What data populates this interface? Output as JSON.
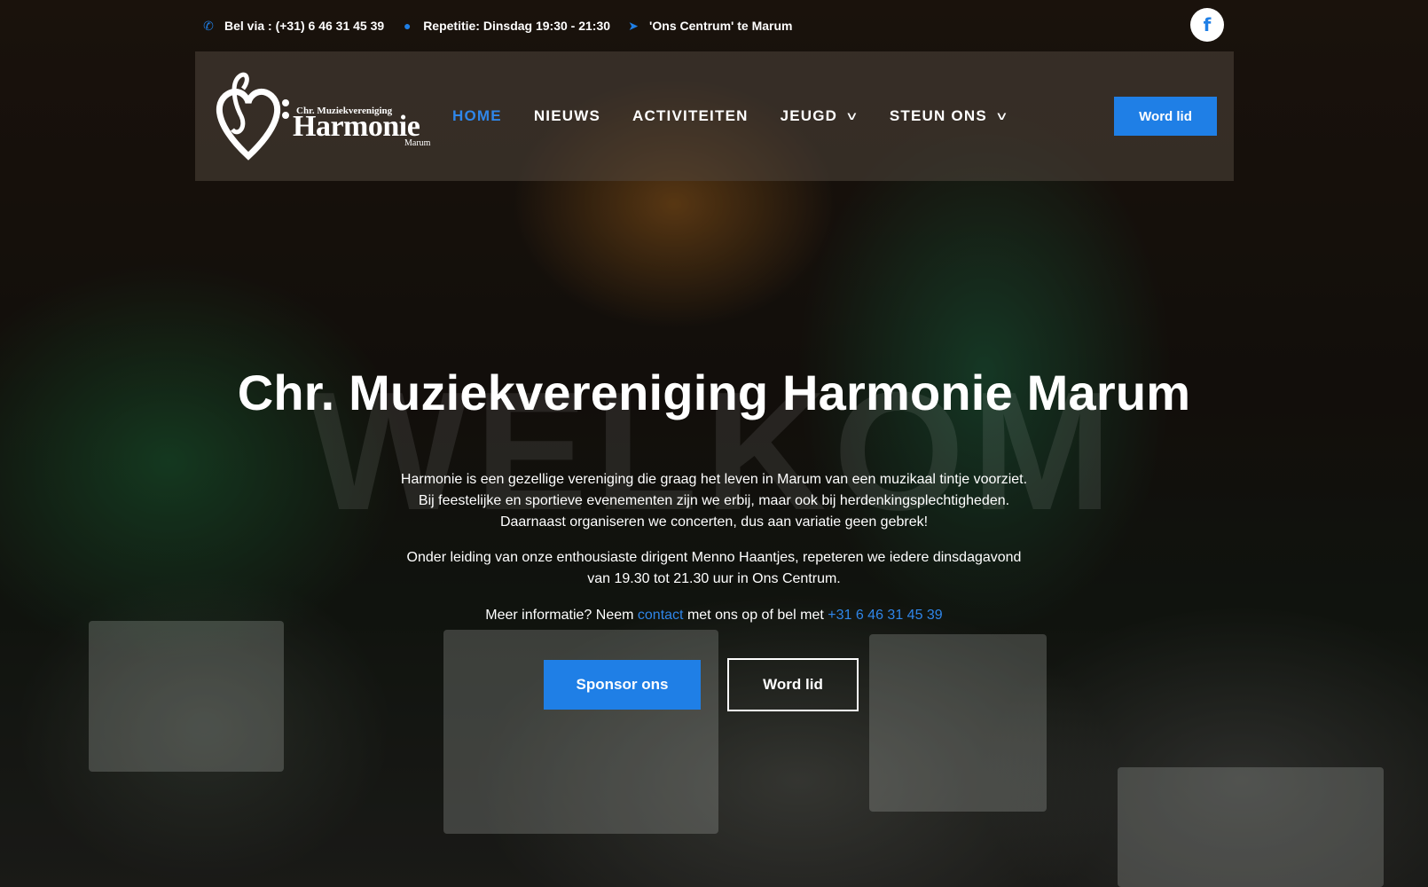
{
  "topbar": {
    "phone": "Bel via : (+31) 6 46 31 45 39",
    "rehearsal": "Repetitie: Dinsdag 19:30 - 21:30",
    "location": "'Ons Centrum' te Marum",
    "facebook_icon": "f"
  },
  "logo": {
    "small": "Chr. Muziekvereniging",
    "big": "Harmonie",
    "tiny": "Marum"
  },
  "nav": {
    "items": [
      {
        "label": "HOME"
      },
      {
        "label": "NIEUWS"
      },
      {
        "label": "ACTIVITEITEN"
      },
      {
        "label": "JEUGD"
      },
      {
        "label": "STEUN ONS"
      }
    ],
    "cta": "Word lid"
  },
  "hero": {
    "watermark": "WELKOM",
    "title": "Chr. Muziekvereniging Harmonie Marum",
    "paragraph1_line1": "Harmonie is een gezellige vereniging die graag het leven in Marum van een muzikaal tintje voorziet.",
    "paragraph1_line2": "Bij feestelijke en sportieve evenementen zijn we erbij, maar ook bij herdenkingsplechtigheden.",
    "paragraph1_line3": "Daarnaast organiseren we concerten, dus aan variatie geen gebrek!",
    "paragraph2_line1": "Onder leiding van onze enthousiaste dirigent Menno Haantjes, repeteren we iedere dinsdagavond",
    "paragraph2_line2": "van 19.30 tot 21.30 uur in Ons Centrum.",
    "paragraph3_pre": "Meer informatie? Neem ",
    "paragraph3_link": "contact",
    "paragraph3_mid": " met ons op of bel met ",
    "paragraph3_phone": "+31 6 46 31 45 39",
    "sponsor_button": "Sponsor ons",
    "join_button": "Word lid"
  },
  "colors": {
    "accent": "#1f7fe6"
  }
}
